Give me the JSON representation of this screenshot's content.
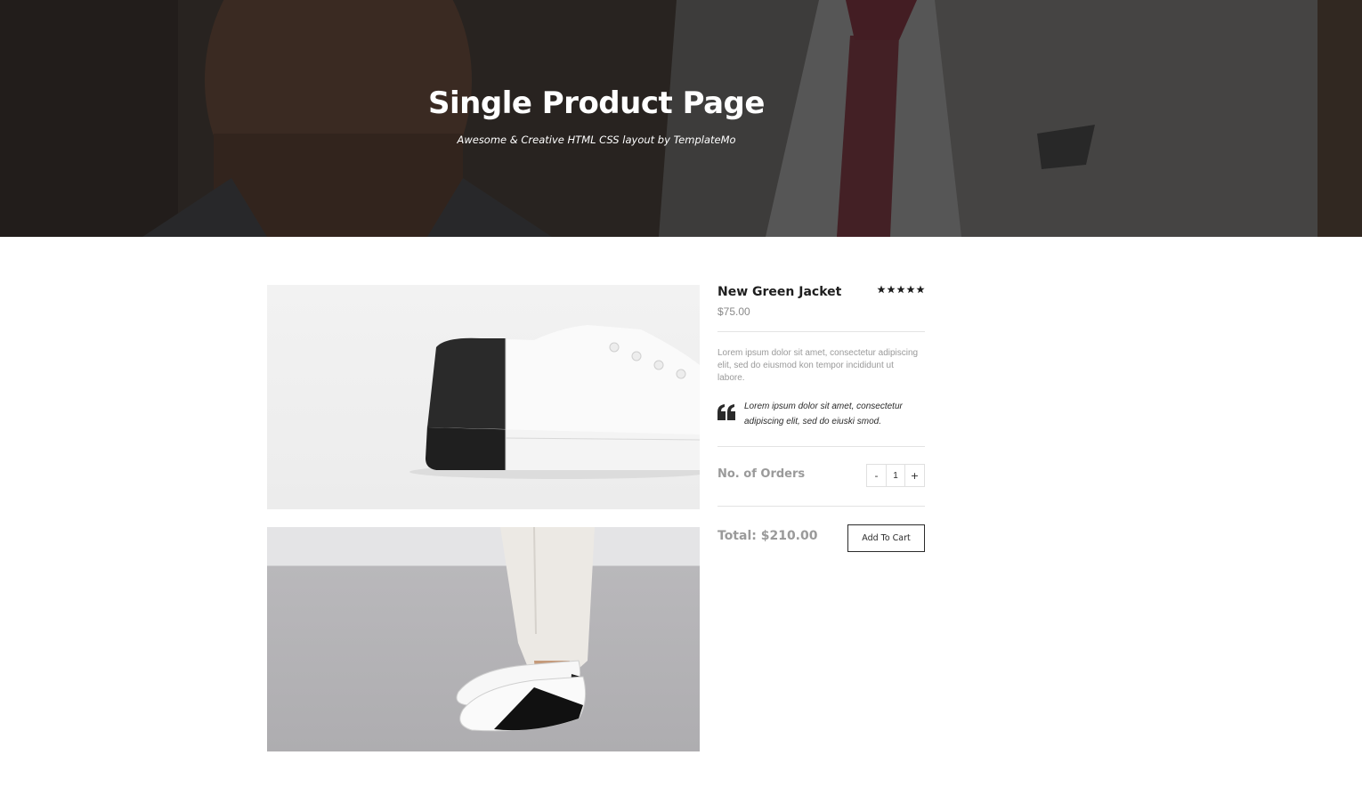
{
  "hero": {
    "title": "Single Product Page",
    "subtitle": "Awesome & Creative HTML CSS layout by TemplateMo"
  },
  "product": {
    "name": "New Green Jacket",
    "rating": 5,
    "price": "$75.00",
    "description": "Lorem ipsum dolor sit amet, consectetur adipiscing elit, sed do eiusmod kon tempor incididunt ut labore.",
    "quote": "Lorem ipsum dolor sit amet, consectetur adipiscing elit, sed do eiuski smod."
  },
  "order": {
    "label": "No. of Orders",
    "minus": "-",
    "quantity": "1",
    "plus": "+",
    "total": "Total: $210.00",
    "add_to_cart": "Add To Cart"
  }
}
